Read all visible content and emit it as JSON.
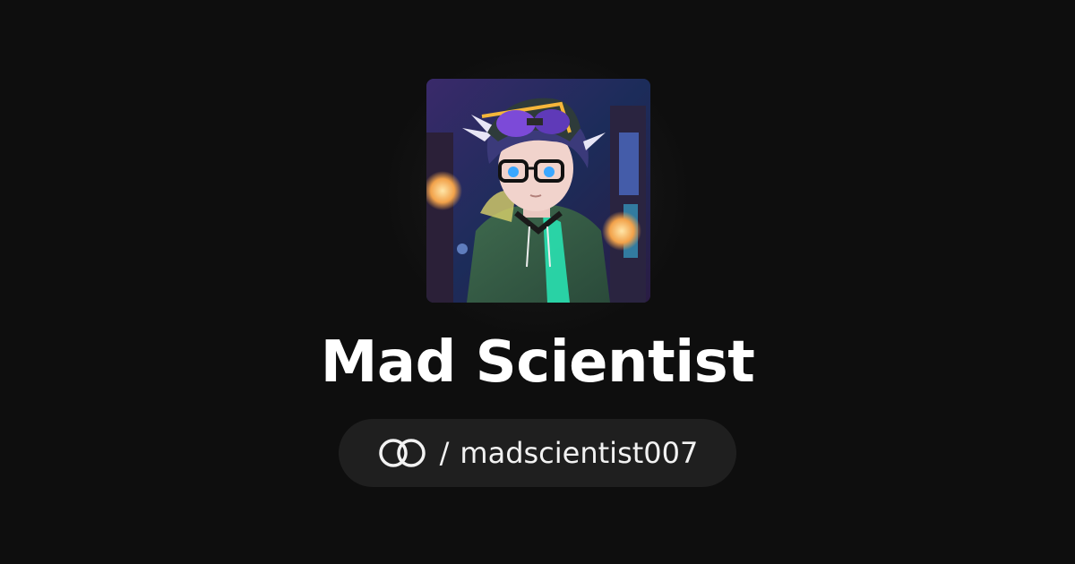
{
  "profile": {
    "name": "Mad Scientist",
    "separator": "/",
    "username": "madscientist007",
    "avatar_icon": "anime-character-avatar",
    "logo_icon": "linked-rings-logo-icon"
  },
  "colors": {
    "background": "#0e0e0e",
    "pill_background": "#1f1f1f",
    "text": "#ffffff"
  }
}
